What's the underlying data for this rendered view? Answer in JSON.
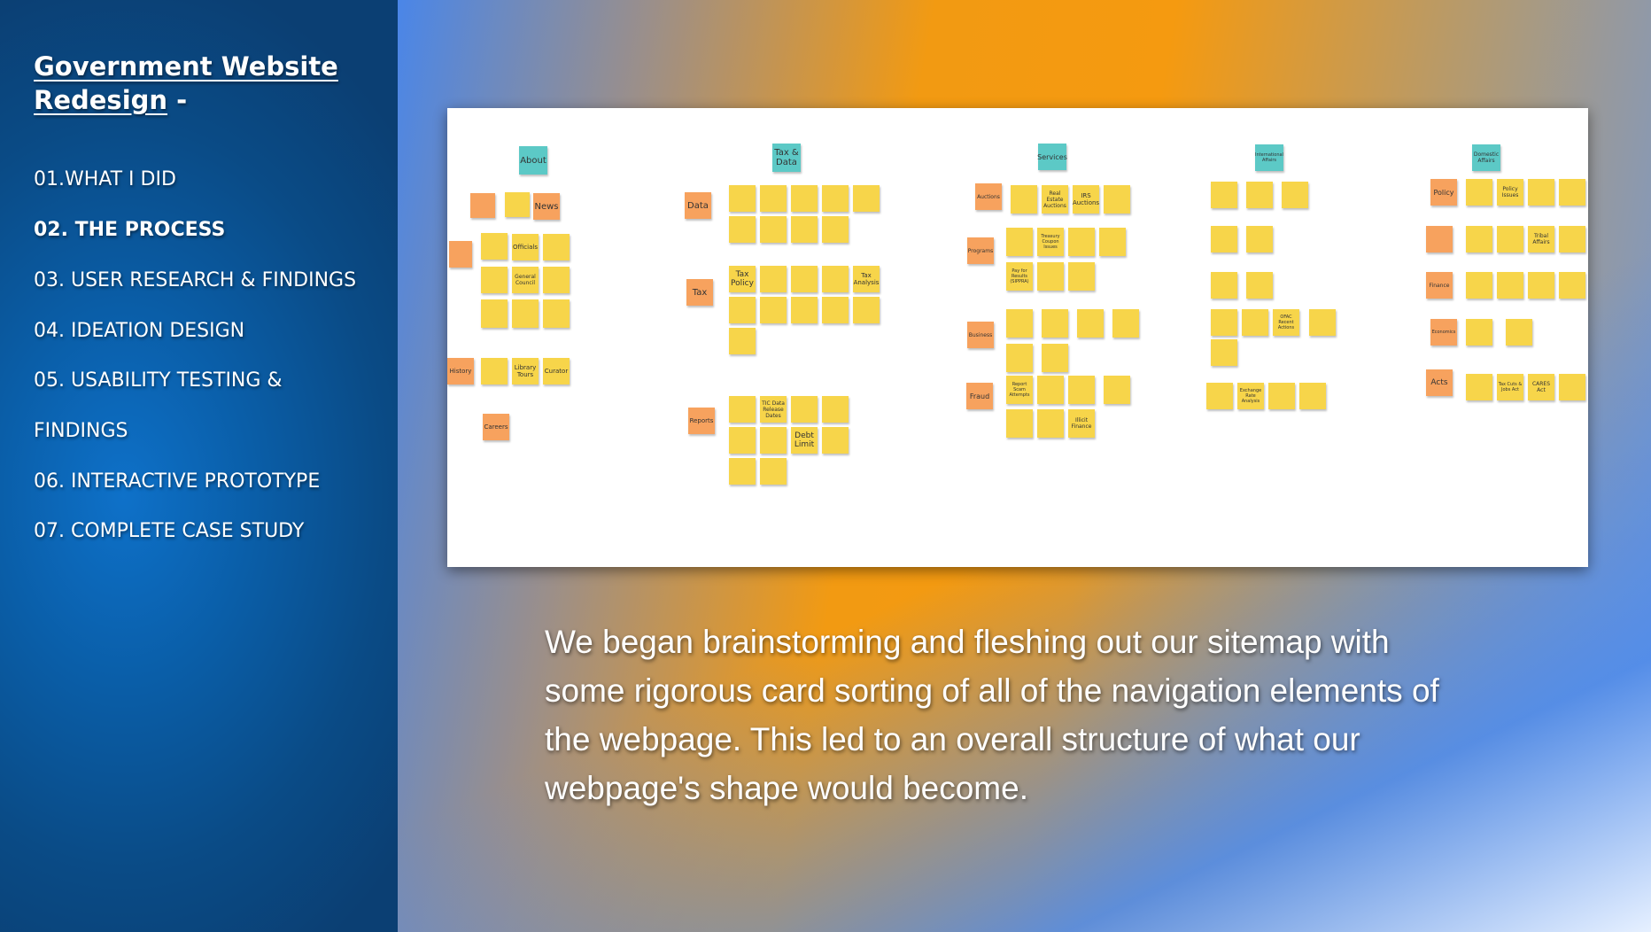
{
  "sidebar": {
    "title": "Government Website Redesign",
    "title_suffix": " -",
    "nav": [
      {
        "label": "01.WHAT I DID",
        "active": false
      },
      {
        "label": "02. THE PROCESS",
        "active": true
      },
      {
        "label": "03. USER RESEARCH & FINDINGS",
        "active": false
      },
      {
        "label": "04. IDEATION DESIGN",
        "active": false
      },
      {
        "label": "05. USABILITY TESTING &",
        "active": false
      },
      {
        "label": "FINDINGS",
        "active": false
      },
      {
        "label": "06. INTERACTIVE PROTOTYPE",
        "active": false
      },
      {
        "label": "07. COMPLETE CASE STUDY",
        "active": false
      }
    ]
  },
  "board": {
    "headers": [
      "About",
      "Tax & Data",
      "Services",
      "International Affairs",
      "Domestic Affairs"
    ],
    "categories": [
      "News",
      "History",
      "Careers",
      "Data",
      "Tax",
      "Reports",
      "Auctions",
      "Programs",
      "Business",
      "Fraud",
      "Policy",
      "Finance",
      "Economics",
      "Acts"
    ],
    "cards": [
      "Officials",
      "General Council",
      "Library Tours",
      "Curator",
      "Tax Policy",
      "Tax Analysis",
      "TIC Data Release Dates",
      "Debt Limit",
      "IRS Auctions",
      "Real Estate Auctions",
      "Treasury Coupon Issues",
      "Pay for Results (SIPPRA)",
      "OFAC Recent Actions",
      "Exchange Rate Analysis",
      "Report Scam Attempts",
      "Illicit Finance",
      "Policy Issues",
      "Tribal Affairs",
      "Tax Cuts & Jobs Act",
      "CARES Act"
    ]
  },
  "main": {
    "caption": "We began brainstorming and fleshing out our sitemap with some rigorous card sorting of all of the navigation elements of the webpage. This led to an overall structure of what our webpage's shape would become."
  }
}
